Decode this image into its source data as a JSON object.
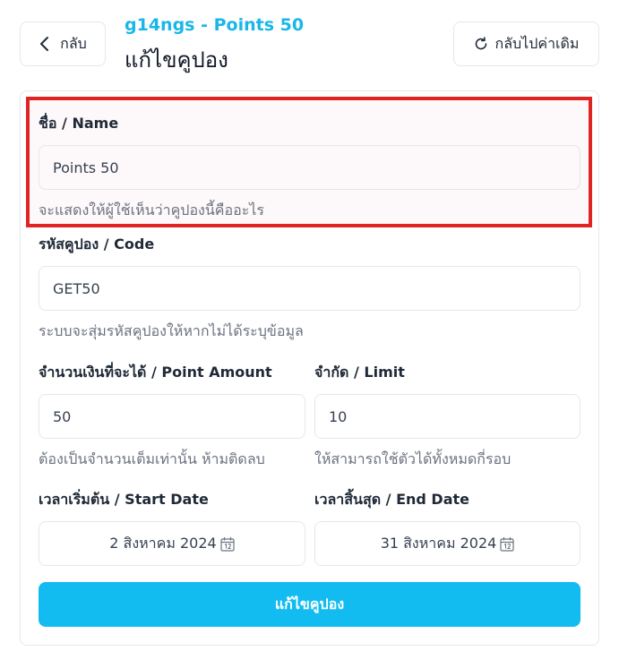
{
  "header": {
    "back_label": "กลับ",
    "subtitle": "g14ngs - Points 50",
    "title": "แก้ไขคูปอง",
    "reset_label": "กลับไปค่าเดิม"
  },
  "form": {
    "name": {
      "label": "ชื่อ / Name",
      "value": "Points 50",
      "help": "จะแสดงให้ผู้ใช้เห็นว่าคูปองนี้คืออะไร"
    },
    "code": {
      "label": "รหัสคูปอง / Code",
      "value": "GET50",
      "help": "ระบบจะสุ่มรหัสคูปองให้หากไม่ได้ระบุข้อมูล"
    },
    "amount": {
      "label": "จำนวนเงินที่จะได้ / Point Amount",
      "value": "50",
      "help": "ต้องเป็นจำนวนเต็มเท่านั้น ห้ามติดลบ"
    },
    "limit": {
      "label": "จำกัด / Limit",
      "value": "10",
      "help": "ให้สามารถใช้ตัวได้ทั้งหมดกี่รอบ"
    },
    "start_date": {
      "label": "เวลาเริ่มต้น / Start Date",
      "value": "2 สิงหาคม 2024",
      "icon": "calendar-icon"
    },
    "end_date": {
      "label": "เวลาสิ้นสุด / End Date",
      "value": "31 สิงหาคม 2024",
      "icon": "calendar-icon"
    },
    "submit_label": "แก้ไขคูปอง"
  },
  "colors": {
    "accent": "#19b7e8",
    "button": "#13bcf0",
    "highlight_border": "#e02424"
  }
}
